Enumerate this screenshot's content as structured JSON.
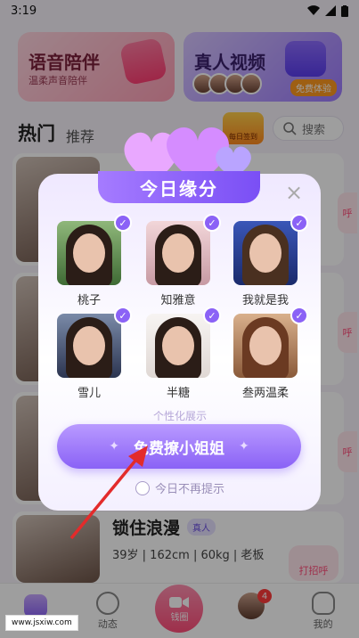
{
  "status_bar": {
    "time": "3:19"
  },
  "banners": {
    "voice": {
      "title": "语音陪伴",
      "subtitle": "温柔声音陪伴"
    },
    "video": {
      "title": "真人视频",
      "badge": "免费体验"
    }
  },
  "tabs": {
    "hot": "热门",
    "recommend": "推荐"
  },
  "signin_badge": "每日签到",
  "search": {
    "label": "搜索"
  },
  "side_greet": "呼",
  "bg_user": {
    "name": "锁住浪漫",
    "badge": "真人",
    "info": "39岁 | 162cm | 60kg | 老板",
    "greet": "打招呼"
  },
  "modal": {
    "title": "今日缘分",
    "close": "×",
    "people": [
      {
        "name": "桃子"
      },
      {
        "name": "知雅意"
      },
      {
        "name": "我就是我"
      },
      {
        "name": "雪儿"
      },
      {
        "name": "半糖"
      },
      {
        "name": "叁两温柔"
      }
    ],
    "personalized_label": "个性化展示",
    "cta_label": "免费撩小姐姐",
    "no_remind_label": "今日不再提示"
  },
  "bottom_nav": {
    "dynamic": "动态",
    "center": "钱圈",
    "message_badge": "4",
    "mine": "我的"
  },
  "watermark": "www.jsxiw.com",
  "colors": {
    "accent": "#8a62f6",
    "pink": "#ff4d79"
  }
}
